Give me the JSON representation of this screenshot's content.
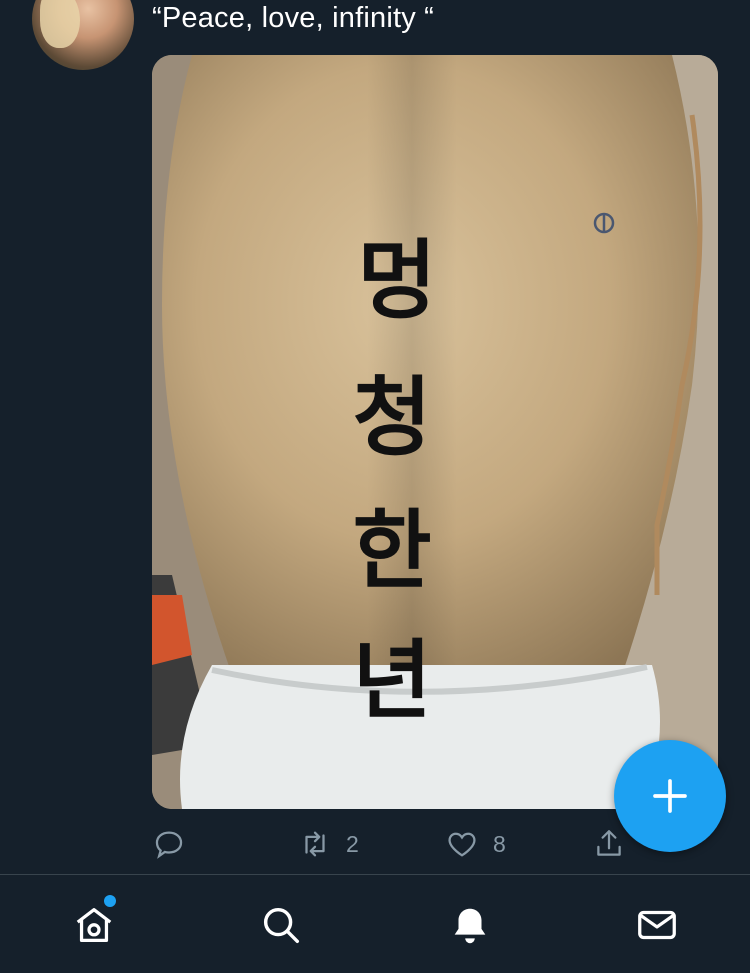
{
  "tweet": {
    "text": "“Peace, love, infinity “"
  },
  "media": {
    "tattoo_chars": [
      "멍",
      "청",
      "한",
      "년"
    ]
  },
  "actions": {
    "reply_count": "",
    "retweet_count": "2",
    "like_count": "8"
  },
  "colors": {
    "background": "#15202b",
    "accent": "#1da1f2",
    "icon_muted": "#8899a6",
    "divider": "#38444d"
  },
  "icons": {
    "reply": "speech-bubble-icon",
    "retweet": "retweet-icon",
    "like": "heart-icon",
    "share": "share-icon",
    "compose": "plus-icon",
    "home": "home-icon",
    "search": "search-icon",
    "notifications": "bell-icon",
    "messages": "envelope-icon"
  }
}
